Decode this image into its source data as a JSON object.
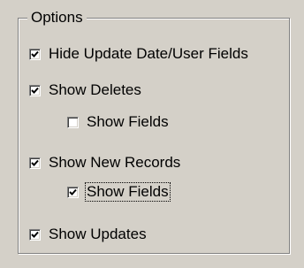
{
  "options_group": {
    "title": "Options",
    "items": [
      {
        "label": "Hide Update Date/User Fields",
        "checked": true,
        "focused": false
      },
      {
        "label": "Show Deletes",
        "checked": true,
        "focused": false
      },
      {
        "label": "Show Fields",
        "checked": false,
        "focused": false
      },
      {
        "label": "Show New Records",
        "checked": true,
        "focused": false
      },
      {
        "label": "Show Fields",
        "checked": true,
        "focused": true
      },
      {
        "label": "Show Updates",
        "checked": true,
        "focused": false
      }
    ]
  }
}
